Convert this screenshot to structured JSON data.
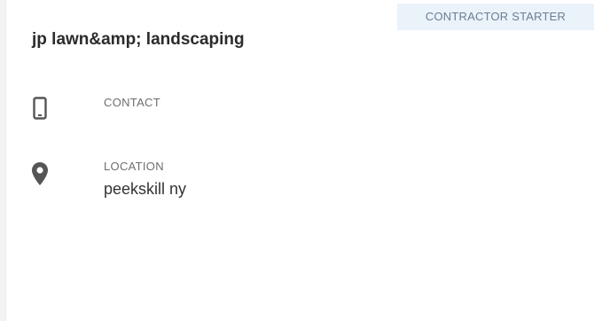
{
  "card": {
    "badge": "CONTRACTOR STARTER",
    "title": "jp lawn&amp; landscaping",
    "contact": {
      "label": "CONTACT",
      "value": "",
      "icon": "mobile-phone-icon"
    },
    "location": {
      "label": "LOCATION",
      "value": "peekskill ny",
      "icon": "map-pin-icon"
    }
  },
  "colors": {
    "badge_bg": "#eaf2fa",
    "icon": "#555555",
    "title": "#2b2b2b"
  }
}
